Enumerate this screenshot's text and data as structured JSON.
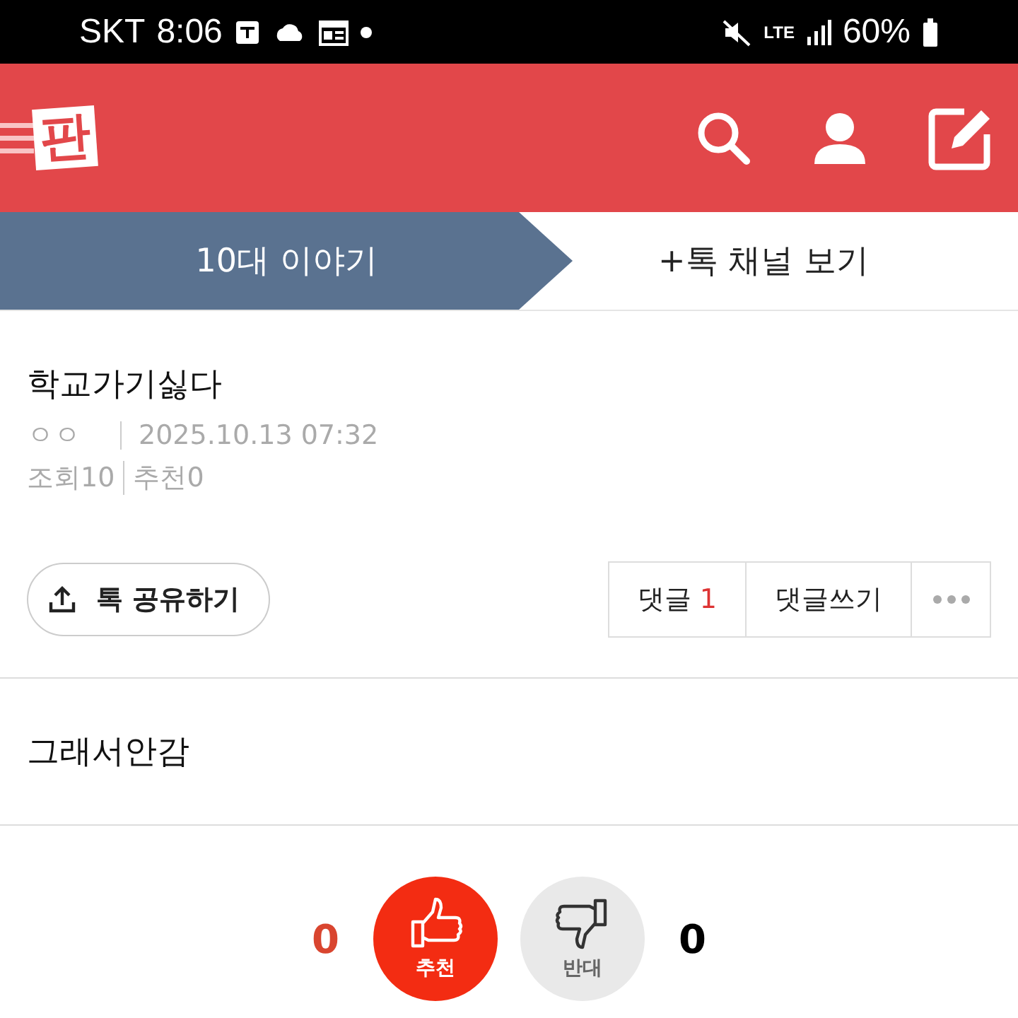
{
  "status_bar": {
    "carrier": "SKT",
    "time": "8:06",
    "network": "LTE",
    "battery": "60%"
  },
  "header": {
    "logo": "판"
  },
  "tabs": [
    {
      "label": "10대 이야기",
      "selected": true
    },
    {
      "label": "+톡 채널 보기",
      "selected": false
    }
  ],
  "post": {
    "title": "학교가기싫다",
    "author": "ㅇㅇ",
    "date": "2025.10.13 07:32",
    "views_label": "조회",
    "views": "10",
    "likes_label": "추천",
    "likes": "0",
    "body": "그래서안감"
  },
  "share_button": "톡 공유하기",
  "comment_buttons": [
    {
      "label": "댓글",
      "count": "1"
    },
    {
      "label": "댓글쓰기"
    }
  ],
  "vote": {
    "up_count": "0",
    "up_label": "추천",
    "down_label": "반대",
    "down_count": "0"
  }
}
